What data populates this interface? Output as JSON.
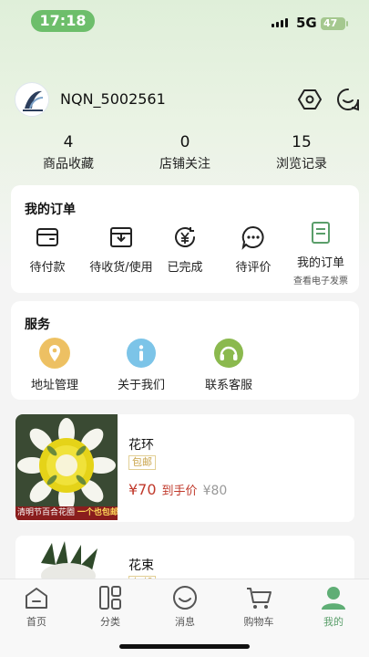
{
  "status_bar": {
    "time": "17:18",
    "network": "5G",
    "battery": "47"
  },
  "profile": {
    "username": "NQN_5002561"
  },
  "stats": [
    {
      "value": "4",
      "label": "商品收藏"
    },
    {
      "value": "0",
      "label": "店铺关注"
    },
    {
      "value": "15",
      "label": "浏览记录"
    }
  ],
  "orders": {
    "title": "我的订单",
    "items": [
      {
        "label": "待付款",
        "icon": "wallet-icon"
      },
      {
        "label": "待收货/使用",
        "icon": "box-icon"
      },
      {
        "label": "已完成",
        "icon": "yen-icon"
      },
      {
        "label": "待评价",
        "icon": "chat-icon"
      },
      {
        "label": "我的订单",
        "sub": "查看电子发票",
        "icon": "document-icon"
      }
    ]
  },
  "services": {
    "title": "服务",
    "items": [
      {
        "label": "地址管理",
        "icon": "location-icon",
        "color": "#e8b44a"
      },
      {
        "label": "关于我们",
        "icon": "info-icon",
        "color": "#7cc4e8"
      },
      {
        "label": "联系客服",
        "icon": "headset-icon",
        "color": "#8bb94e"
      }
    ]
  },
  "products": [
    {
      "name": "花环",
      "tag": "包邮",
      "price": "¥70",
      "price_label": "到手价",
      "original": "¥80",
      "banner_a": "清明节百合花圈",
      "banner_b": "一个也包邮"
    },
    {
      "name": "花束",
      "tag": "包邮"
    }
  ],
  "tabbar": [
    {
      "label": "首页",
      "icon": "home-icon"
    },
    {
      "label": "分类",
      "icon": "category-icon"
    },
    {
      "label": "消息",
      "icon": "message-icon"
    },
    {
      "label": "购物车",
      "icon": "cart-icon"
    },
    {
      "label": "我的",
      "icon": "profile-icon",
      "active": true
    }
  ],
  "colors": {
    "accent": "#5a9e6a",
    "price": "#c0392b",
    "status_pill": "#6dbe6b"
  }
}
